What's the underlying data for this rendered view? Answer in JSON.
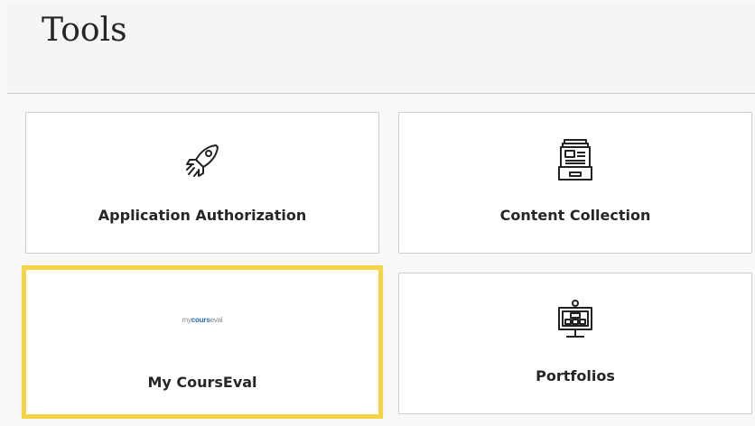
{
  "page": {
    "title": "Tools"
  },
  "tools": [
    {
      "label": "Application Authorization",
      "icon": "rocket-icon"
    },
    {
      "label": "Content Collection",
      "icon": "file-cabinet-icon"
    },
    {
      "label": "My CoursEval",
      "icon": "mycourseval-logo",
      "logo": {
        "prefix": "my",
        "accent": "cours",
        "suffix": "eval"
      }
    },
    {
      "label": "Portfolios",
      "icon": "presentation-board-icon"
    }
  ],
  "focus_color": "#f7d444"
}
